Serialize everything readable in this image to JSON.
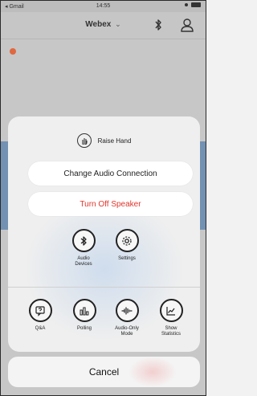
{
  "status_bar": {
    "carrier": "◂ Gmail",
    "time": "14:55"
  },
  "nav": {
    "title": "Webex",
    "chevron": "⌄"
  },
  "sheet": {
    "raise_hand_label": "Raise Hand",
    "change_audio_label": "Change Audio Connection",
    "turn_off_speaker_label": "Turn Off Speaker",
    "row1": [
      {
        "label": "Audio Devices",
        "icon": "bluetooth-icon"
      },
      {
        "label": "Settings",
        "icon": "gear-icon"
      }
    ],
    "row2": [
      {
        "label": "Q&A",
        "icon": "qa-icon"
      },
      {
        "label": "Polling",
        "icon": "polling-icon"
      },
      {
        "label": "Audio-Only Mode",
        "icon": "audio-wave-icon"
      },
      {
        "label": "Show Statistics",
        "icon": "statistics-icon"
      }
    ]
  },
  "cancel_label": "Cancel",
  "colors": {
    "danger": "#e2352b",
    "accent_dot": "#e0683f"
  }
}
